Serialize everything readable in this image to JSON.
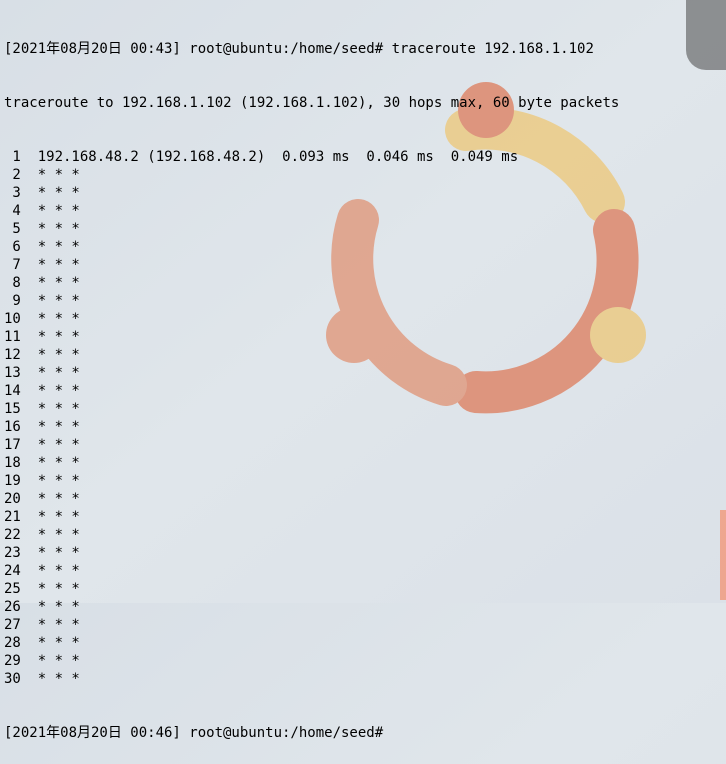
{
  "terminal": {
    "prompt_start": "[2021年08月20日 00:43] root@ubuntu:/home/seed# ",
    "command": "traceroute 192.168.1.102",
    "header": "traceroute to 192.168.1.102 (192.168.1.102), 30 hops max, 60 byte packets",
    "hops": [
      {
        "n": " 1",
        "body": "  192.168.48.2 (192.168.48.2)  0.093 ms  0.046 ms  0.049 ms"
      },
      {
        "n": " 2",
        "body": "  * * *"
      },
      {
        "n": " 3",
        "body": "  * * *"
      },
      {
        "n": " 4",
        "body": "  * * *"
      },
      {
        "n": " 5",
        "body": "  * * *"
      },
      {
        "n": " 6",
        "body": "  * * *"
      },
      {
        "n": " 7",
        "body": "  * * *"
      },
      {
        "n": " 8",
        "body": "  * * *"
      },
      {
        "n": " 9",
        "body": "  * * *"
      },
      {
        "n": "10",
        "body": "  * * *"
      },
      {
        "n": "11",
        "body": "  * * *"
      },
      {
        "n": "12",
        "body": "  * * *"
      },
      {
        "n": "13",
        "body": "  * * *"
      },
      {
        "n": "14",
        "body": "  * * *"
      },
      {
        "n": "15",
        "body": "  * * *"
      },
      {
        "n": "16",
        "body": "  * * *"
      },
      {
        "n": "17",
        "body": "  * * *"
      },
      {
        "n": "18",
        "body": "  * * *"
      },
      {
        "n": "19",
        "body": "  * * *"
      },
      {
        "n": "20",
        "body": "  * * *"
      },
      {
        "n": "21",
        "body": "  * * *"
      },
      {
        "n": "22",
        "body": "  * * *"
      },
      {
        "n": "23",
        "body": "  * * *"
      },
      {
        "n": "24",
        "body": "  * * *"
      },
      {
        "n": "25",
        "body": "  * * *"
      },
      {
        "n": "26",
        "body": "  * * *"
      },
      {
        "n": "27",
        "body": "  * * *"
      },
      {
        "n": "28",
        "body": "  * * *"
      },
      {
        "n": "29",
        "body": "  * * *"
      },
      {
        "n": "30",
        "body": "  * * *"
      }
    ],
    "prompt_end": "[2021年08月20日 00:46] root@ubuntu:/home/seed# "
  }
}
